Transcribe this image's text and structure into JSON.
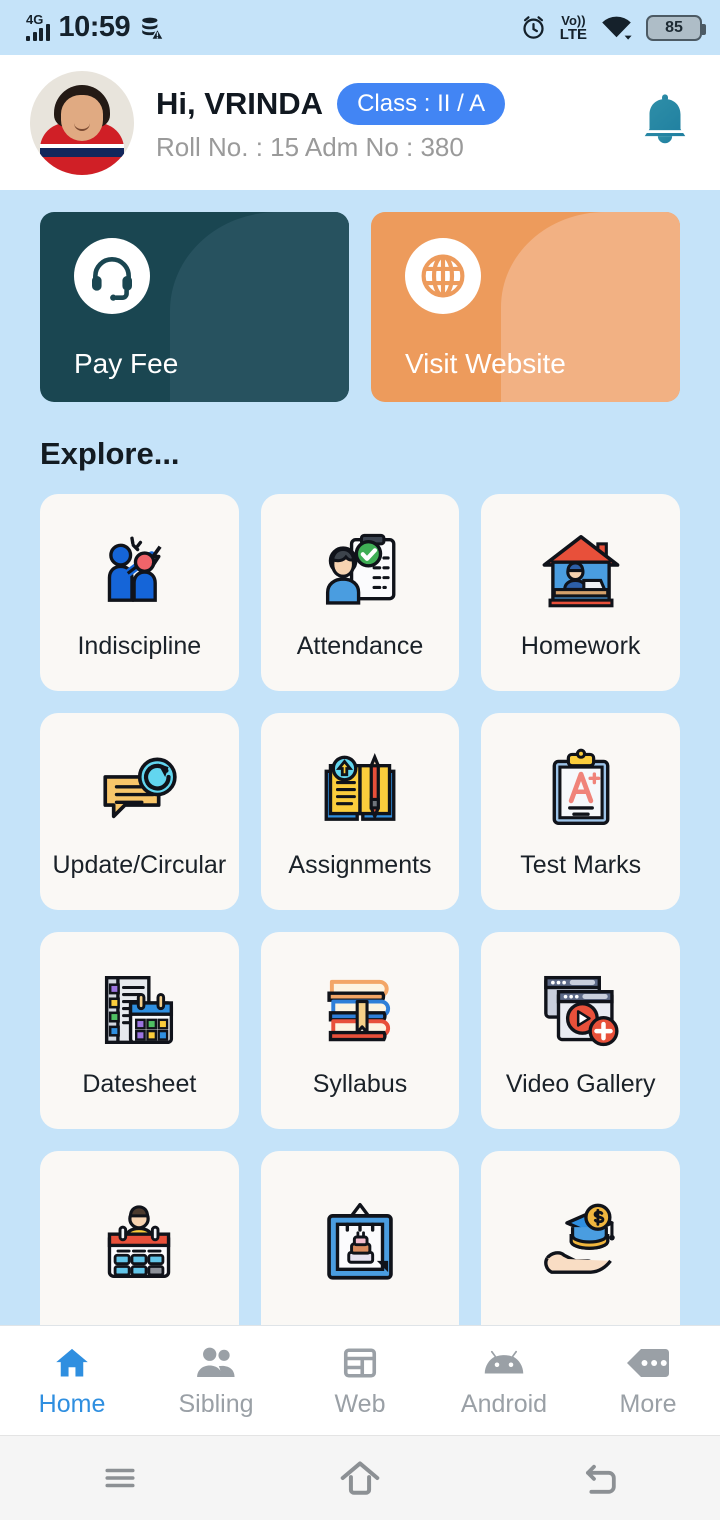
{
  "status_bar": {
    "network_type": "4G",
    "time": "10:59",
    "data_icon": "data-saver-icon",
    "alarm_icon": "alarm-clock-icon",
    "volte_line1": "Vo))",
    "volte_line2": "LTE",
    "wifi_icon": "wifi-icon",
    "battery_level": "85"
  },
  "header": {
    "avatar_alt": "student-photo",
    "greeting": "Hi, VRINDA",
    "class_badge": "Class : II / A",
    "details": "Roll No. : 15  Adm No : 380",
    "bell_icon": "notification-bell-icon",
    "badge_color": "#4285f4",
    "background": "#ffffff"
  },
  "banners": [
    {
      "label": "Pay Fee",
      "icon": "headset-icon",
      "color": "#1a4651",
      "wave_color": "#27525f"
    },
    {
      "label": "Visit Website",
      "icon": "globe-icon",
      "color": "#ed9b5c",
      "wave_color": "#f2b183"
    }
  ],
  "explore": {
    "title": "Explore..."
  },
  "tiles": [
    {
      "label": "Indiscipline",
      "icon": "indiscipline-icon"
    },
    {
      "label": "Attendance",
      "icon": "attendance-clipboard-icon"
    },
    {
      "label": "Homework",
      "icon": "home-study-icon"
    },
    {
      "label": "Update/Circular",
      "icon": "update-circular-icon"
    },
    {
      "label": "Assignments",
      "icon": "open-book-pencil-icon"
    },
    {
      "label": "Test Marks",
      "icon": "grade-clipboard-icon"
    },
    {
      "label": "Datesheet",
      "icon": "datesheet-calendar-icon"
    },
    {
      "label": "Syllabus",
      "icon": "book-stack-icon"
    },
    {
      "label": "Video Gallery",
      "icon": "video-gallery-icon"
    },
    {
      "label": "",
      "icon": "leave-calendar-icon"
    },
    {
      "label": "",
      "icon": "birthday-frame-icon"
    },
    {
      "label": "",
      "icon": "scholarship-icon"
    }
  ],
  "bottom_nav": {
    "active_color": "#2f8fe0",
    "inactive_color": "#9aa0a6",
    "items": [
      {
        "label": "Home",
        "icon": "home-icon",
        "active": true
      },
      {
        "label": "Sibling",
        "icon": "people-icon",
        "active": false
      },
      {
        "label": "Web",
        "icon": "web-icon",
        "active": false
      },
      {
        "label": "Android",
        "icon": "android-icon",
        "active": false
      },
      {
        "label": "More",
        "icon": "more-dots-icon",
        "active": false
      }
    ]
  },
  "system_nav": {
    "items": [
      {
        "icon": "recents-menu-icon"
      },
      {
        "icon": "home-outline-icon"
      },
      {
        "icon": "back-arrow-icon"
      }
    ]
  },
  "theme": {
    "page_background": "#c5e3f9",
    "tile_background": "#faf8f5"
  }
}
